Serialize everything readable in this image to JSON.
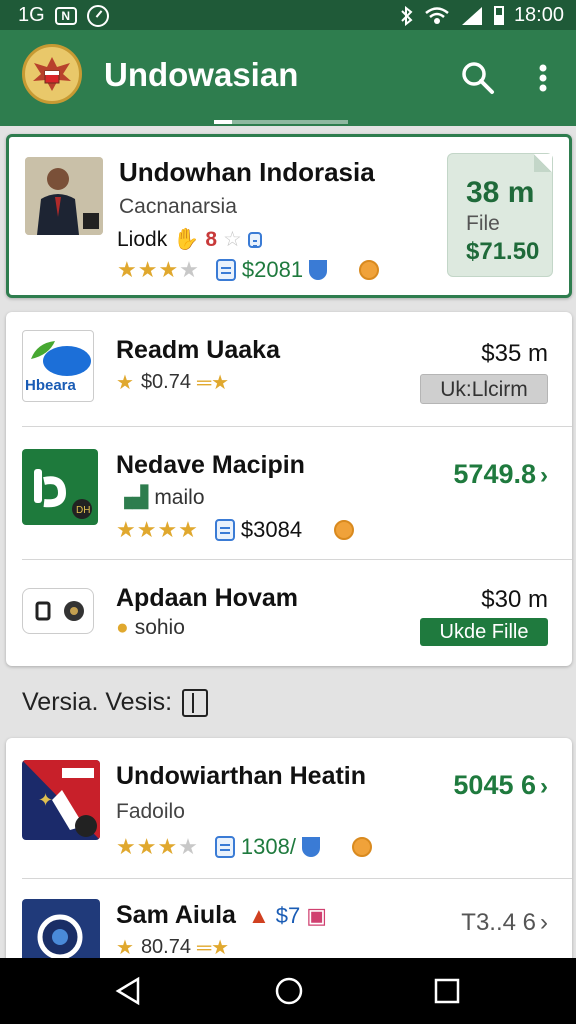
{
  "status_bar": {
    "left_text": "1G",
    "box_glyph": "N",
    "time": "18:00"
  },
  "app_bar": {
    "title": "Undowasian"
  },
  "featured": {
    "title": "Undowhan Indorasia",
    "subtitle": "Cacnanarsia",
    "tag": "Liodk",
    "price": "$2081",
    "file_size": "38 m",
    "file_label": "File",
    "file_price": "$71.50",
    "rating": 3.5
  },
  "list1": [
    {
      "title": "Readm Uaaka",
      "logo_text": "Hbeara",
      "meta": "$0.74",
      "price": "$35 m",
      "button": "Uk:Llcirm",
      "rating": 1
    },
    {
      "title": "Nedave Macipin",
      "meta": "mailo",
      "price_sub": "$3084",
      "right": "5749.8",
      "rating": 4
    },
    {
      "title": "Apdaan Hovam",
      "meta": "sohio",
      "price": "$30 m",
      "button": "Ukde Fille"
    }
  ],
  "section": {
    "label": "Versia. Vesis:"
  },
  "list2": [
    {
      "title": "Undowiarthan Heatin",
      "subtitle": "Fadoilo",
      "price": "1308/",
      "right": "5045 6",
      "rating": 3.5
    },
    {
      "title": "Sam Aiula",
      "price_tag": "$7",
      "meta": "80.74",
      "right": "T3..4 6",
      "rating": 1
    }
  ],
  "colors": {
    "primary": "#2e7d4e",
    "status": "#1f5a38",
    "price_green": "#1f7a3e",
    "star": "#e0a82e"
  },
  "icons": {
    "search": "search-icon",
    "menu": "more-vert-icon",
    "back": "back-icon",
    "home": "home-icon",
    "recents": "recents-icon"
  }
}
